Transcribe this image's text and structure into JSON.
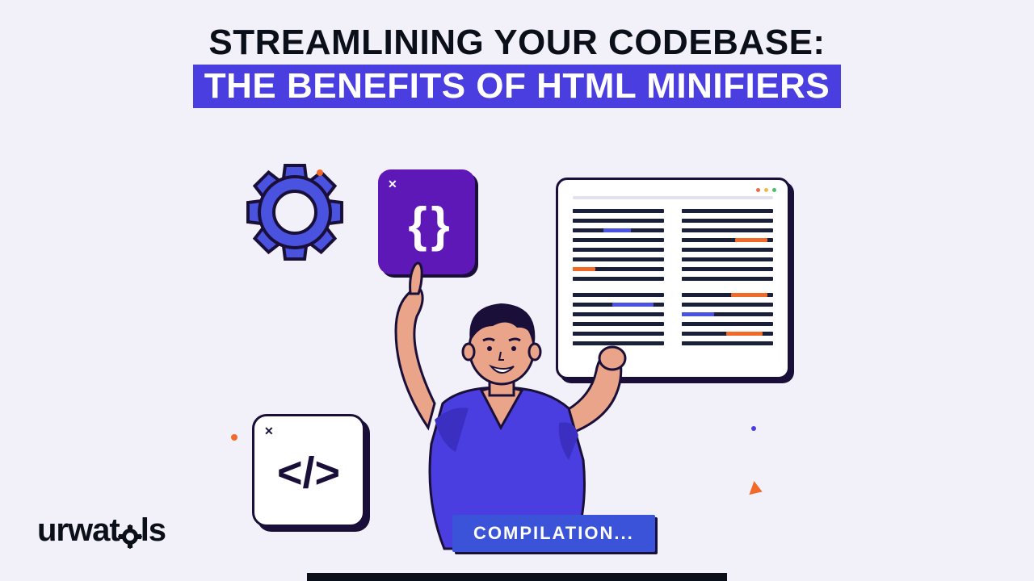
{
  "title": {
    "line1": "STREAMLINING YOUR CODEBASE:",
    "line2": "THE BENEFITS OF HTML MINIFIERS"
  },
  "pill_label": "COMPILATION...",
  "logo": {
    "part1": "urwat",
    "part2": "ls"
  },
  "cards": {
    "code_braces": "{ }",
    "html_tag": "</>",
    "close_x": "✕"
  },
  "colors": {
    "accent_purple": "#4a3ee0",
    "accent_orange": "#f06a2a",
    "deep_purple": "#5e18b8",
    "ink": "#1a1f3a"
  }
}
